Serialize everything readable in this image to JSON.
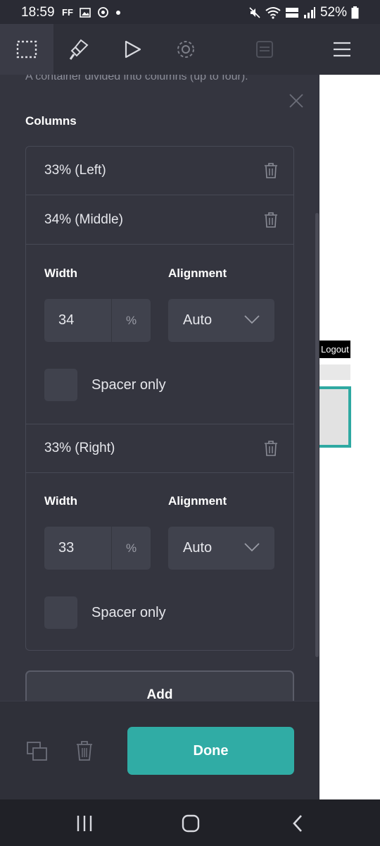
{
  "status_bar": {
    "time": "18:59",
    "left_icons": [
      "ff-icon",
      "image-icon",
      "sync-icon",
      "dot"
    ],
    "ff_text": "FF",
    "battery": "52%",
    "right_icons": [
      "mute-icon",
      "wifi-icon",
      "lte-icon",
      "signal-icon",
      "battery-icon"
    ]
  },
  "toolbar": {
    "items": [
      "select-box-icon",
      "brush-icon",
      "play-icon",
      "gear-icon",
      "layers-icon",
      "menu-icon"
    ]
  },
  "panel": {
    "description": "A container divided into columns (up to four).",
    "section_title": "Columns",
    "columns": [
      {
        "label": "33% (Left)"
      },
      {
        "label": "34% (Middle)",
        "width": "34",
        "unit": "%",
        "alignment": "Auto",
        "spacer_label": "Spacer only"
      },
      {
        "label": "33% (Right)",
        "width": "33",
        "unit": "%",
        "alignment": "Auto",
        "spacer_label": "Spacer only"
      }
    ],
    "width_label": "Width",
    "alignment_label": "Alignment",
    "add_label": "Add"
  },
  "actions": {
    "done_label": "Done"
  },
  "background_page": {
    "logout_text": "Logout"
  },
  "colors": {
    "accent": "#30aca5",
    "panel": "#34353f",
    "toolbar": "#2f3039"
  }
}
